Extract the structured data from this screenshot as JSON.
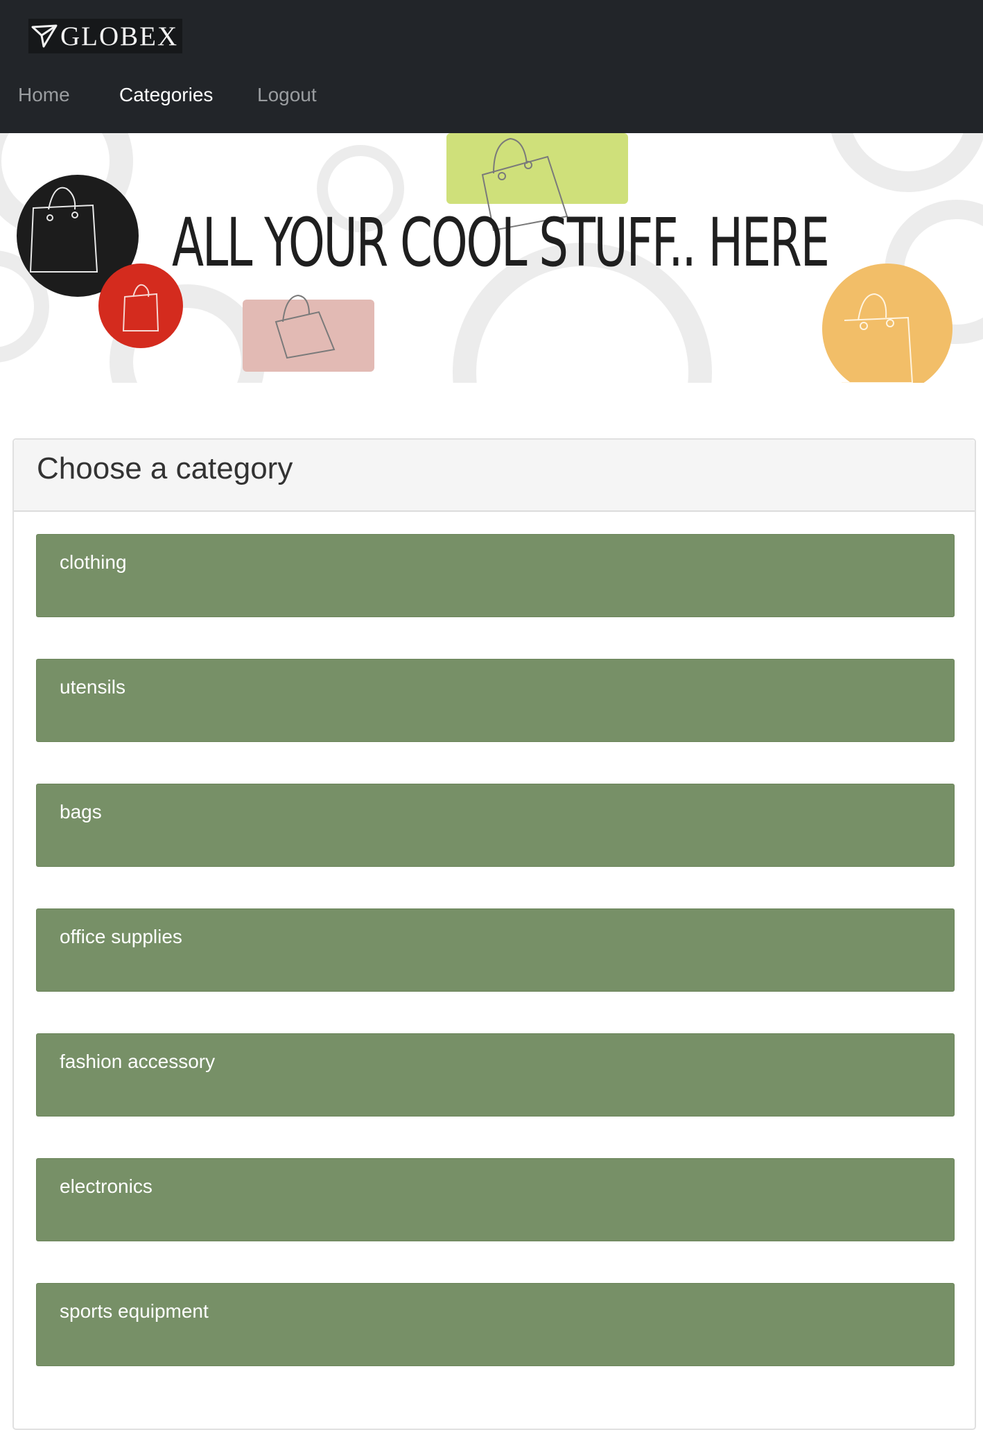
{
  "brand": {
    "name": "GLOBEX",
    "logo_icon": "paper-plane-icon"
  },
  "nav": {
    "items": [
      {
        "label": "Home",
        "active": false
      },
      {
        "label": "Categories",
        "active": true
      },
      {
        "label": "Logout",
        "active": false
      }
    ]
  },
  "banner": {
    "title": "ALL YOUR COOL STUFF.. HERE",
    "colors": {
      "black": "#1c1c1c",
      "red": "#d42b1e",
      "lime": "#cfe07a",
      "pink": "#e2bab4",
      "orange": "#f2be68"
    }
  },
  "panel": {
    "title": "Choose a category"
  },
  "categories": [
    {
      "label": "clothing"
    },
    {
      "label": "utensils"
    },
    {
      "label": "bags"
    },
    {
      "label": "office supplies"
    },
    {
      "label": "fashion accessory"
    },
    {
      "label": "electronics"
    },
    {
      "label": "sports equipment"
    }
  ],
  "colors": {
    "navbar": "#222529",
    "category_bg": "#779067",
    "panel_heading_bg": "#f5f5f5"
  }
}
